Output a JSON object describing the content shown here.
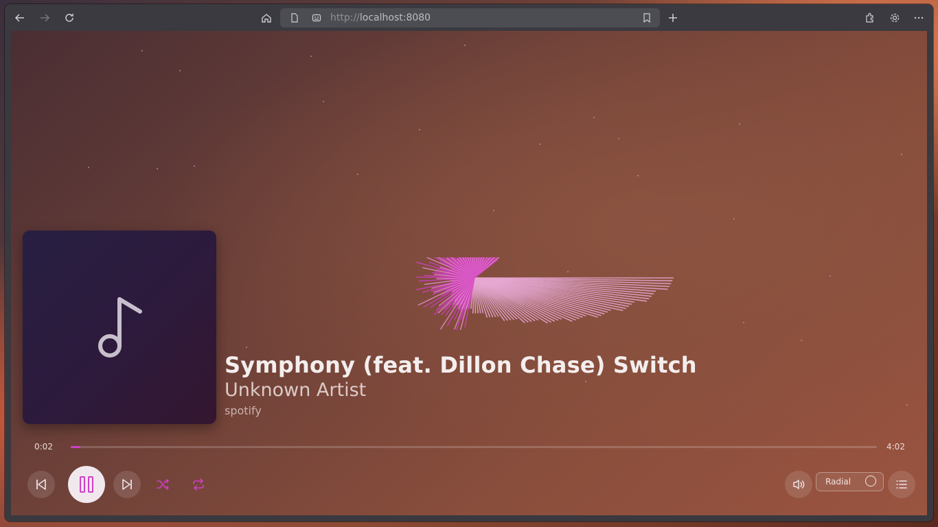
{
  "browser": {
    "url_scheme": "http://",
    "url_host": "localhost:8080",
    "icons": [
      "back-icon",
      "forward-icon",
      "reload-icon",
      "home-icon",
      "page-icon",
      "site-info-icon",
      "bookmark-icon",
      "new-tab-icon",
      "extensions-icon",
      "settings-icon",
      "menu-icon"
    ]
  },
  "player": {
    "title": "Symphony (feat. Dillon Chase) Switch",
    "artist": "Unknown Artist",
    "source": "spotify",
    "elapsed": "0:02",
    "duration": "4:02",
    "progress": 0.008,
    "is_playing": true,
    "visualizer_mode": "Radial",
    "accent_color": "#d03fc6"
  }
}
